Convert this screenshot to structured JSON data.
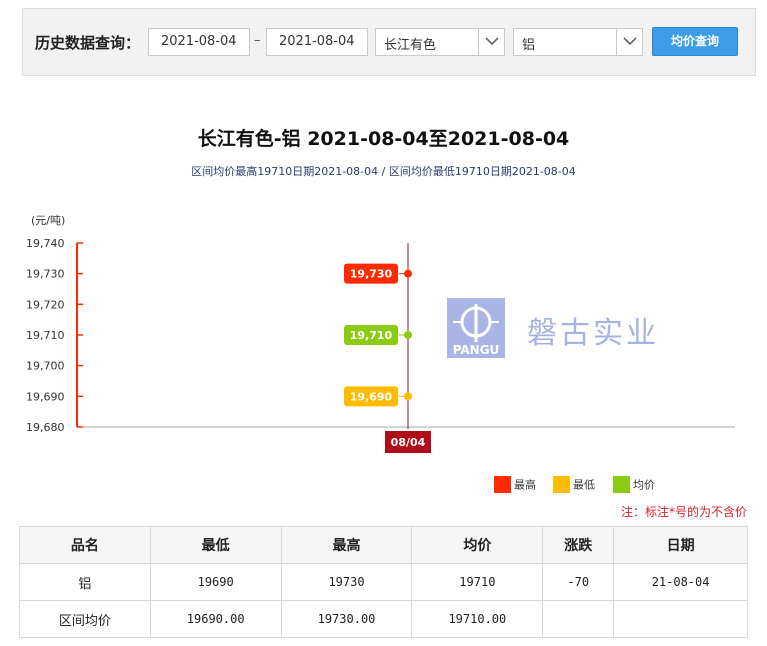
{
  "query": {
    "label": "历史数据查询：",
    "start_date": "2021-08-04",
    "separator": "–",
    "end_date": "2021-08-04",
    "market": "长江有色",
    "metal": "铝",
    "button_label": "均价查询"
  },
  "header": {
    "title": "长江有色-铝 2021-08-04至2021-08-04",
    "subtitle": "区间均价最高19710日期2021-08-04 / 区间均价最低19710日期2021-08-04"
  },
  "watermark": {
    "logo_text": "PANGU",
    "name": "磐古实业"
  },
  "chart_data": {
    "type": "scatter",
    "ylabel": "(元/吨)",
    "ylim": [
      19680,
      19740
    ],
    "yticks": [
      "19,740",
      "19,730",
      "19,720",
      "19,710",
      "19,700",
      "19,690",
      "19,680"
    ],
    "categories": [
      "08/04"
    ],
    "series": [
      {
        "name": "最高",
        "values": [
          19730
        ],
        "labels": [
          "19,730"
        ],
        "color": "#ff2a00"
      },
      {
        "name": "均价",
        "values": [
          19710
        ],
        "labels": [
          "19,710"
        ],
        "color": "#8ccb13"
      },
      {
        "name": "最低",
        "values": [
          19690
        ],
        "labels": [
          "19,690"
        ],
        "color": "#ffbb00"
      }
    ],
    "legend_position": "bottom-right"
  },
  "legend": [
    {
      "label": "最高",
      "color": "#ff2a00"
    },
    {
      "label": "最低",
      "color": "#ffbb00"
    },
    {
      "label": "均价",
      "color": "#8ccb13"
    }
  ],
  "note": "注：标注*号的为不含价",
  "table": {
    "headers": [
      "品名",
      "最低",
      "最高",
      "均价",
      "涨跌",
      "日期"
    ],
    "rows": [
      [
        "铝",
        "19690",
        "19730",
        "19710",
        "-70",
        "21-08-04"
      ],
      [
        "区间均价",
        "19690.00",
        "19730.00",
        "19710.00",
        "",
        ""
      ]
    ]
  }
}
